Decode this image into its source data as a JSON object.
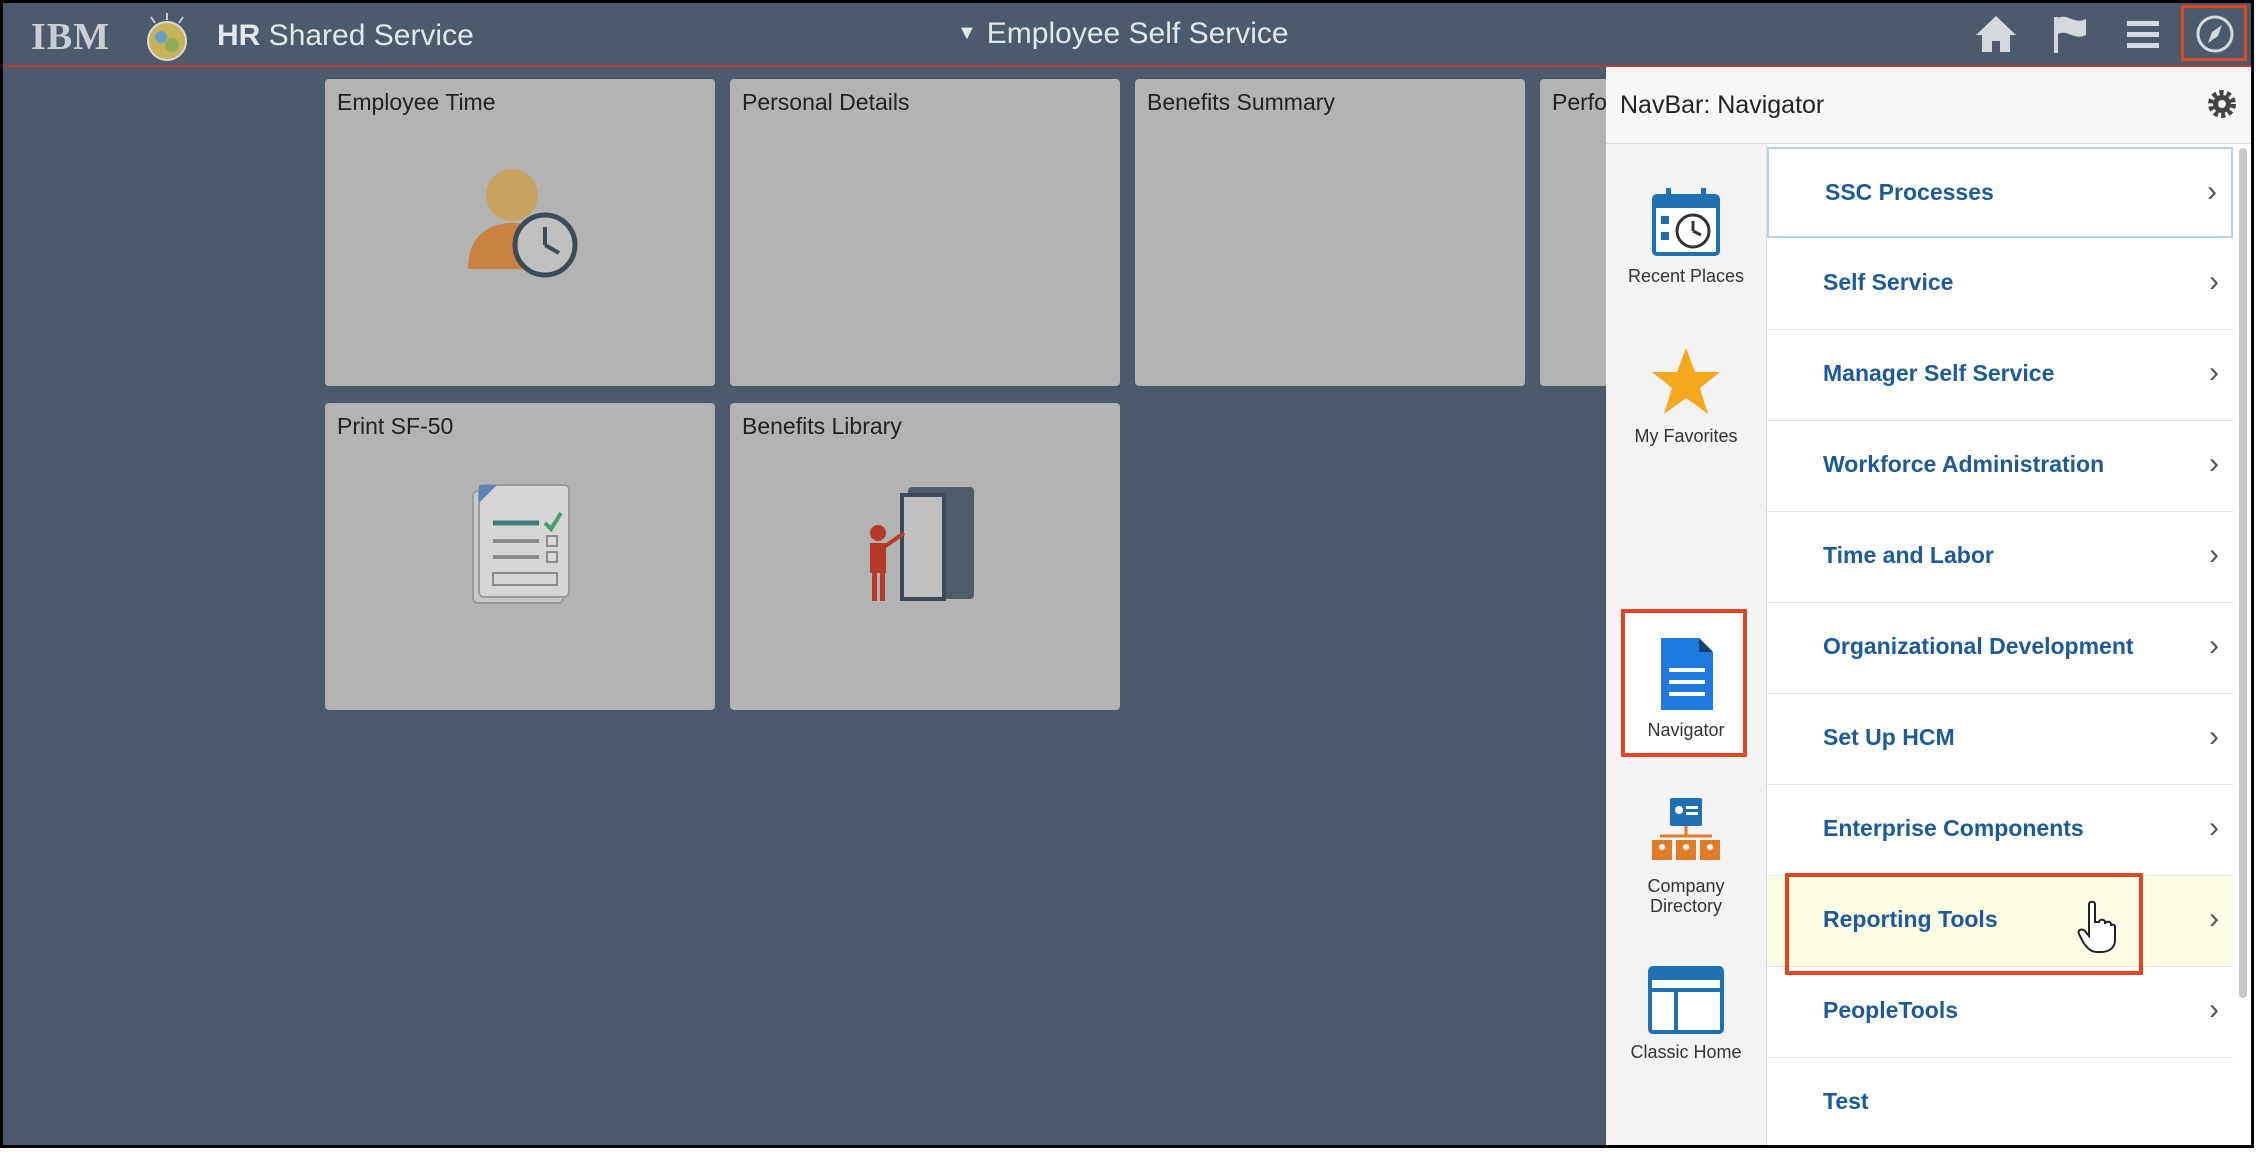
{
  "topbar": {
    "brand": "IBM",
    "app_title_bold": "HR",
    "app_title_rest": " Shared Service",
    "center_title": "Employee Self Service",
    "icons": [
      "home-icon",
      "flag-icon",
      "menu-icon",
      "navbar-compass-icon"
    ]
  },
  "tiles": [
    {
      "title": "Employee Time",
      "icon": "employee-time-icon"
    },
    {
      "title": "Personal Details"
    },
    {
      "title": "Benefits Summary"
    },
    {
      "title": "Perfo"
    },
    {
      "title": "Print SF-50",
      "icon": "document-checklist-icon"
    },
    {
      "title": "Benefits Library",
      "icon": "presenter-door-icon"
    }
  ],
  "navbar": {
    "title": "NavBar: Navigator",
    "side_items": [
      {
        "label": "Recent Places",
        "icon": "calendar-clock-icon"
      },
      {
        "label": "My Favorites",
        "icon": "star-icon"
      },
      {
        "label": "Navigator",
        "icon": "document-icon"
      },
      {
        "label_line1": "Company",
        "label_line2": "Directory",
        "icon": "org-chart-icon"
      },
      {
        "label": "Classic Home",
        "icon": "window-icon"
      }
    ],
    "menu": [
      "SSC Processes",
      "Self Service",
      "Manager Self Service",
      "Workforce Administration",
      "Time and Labor",
      "Organizational Development",
      "Set Up HCM",
      "Enterprise Components",
      "Reporting Tools",
      "PeopleTools",
      "Test"
    ],
    "chevron": "›"
  },
  "colors": {
    "header_bg": "#4b5b6c",
    "highlight": "#e0461f",
    "link": "#1c5a9a"
  }
}
